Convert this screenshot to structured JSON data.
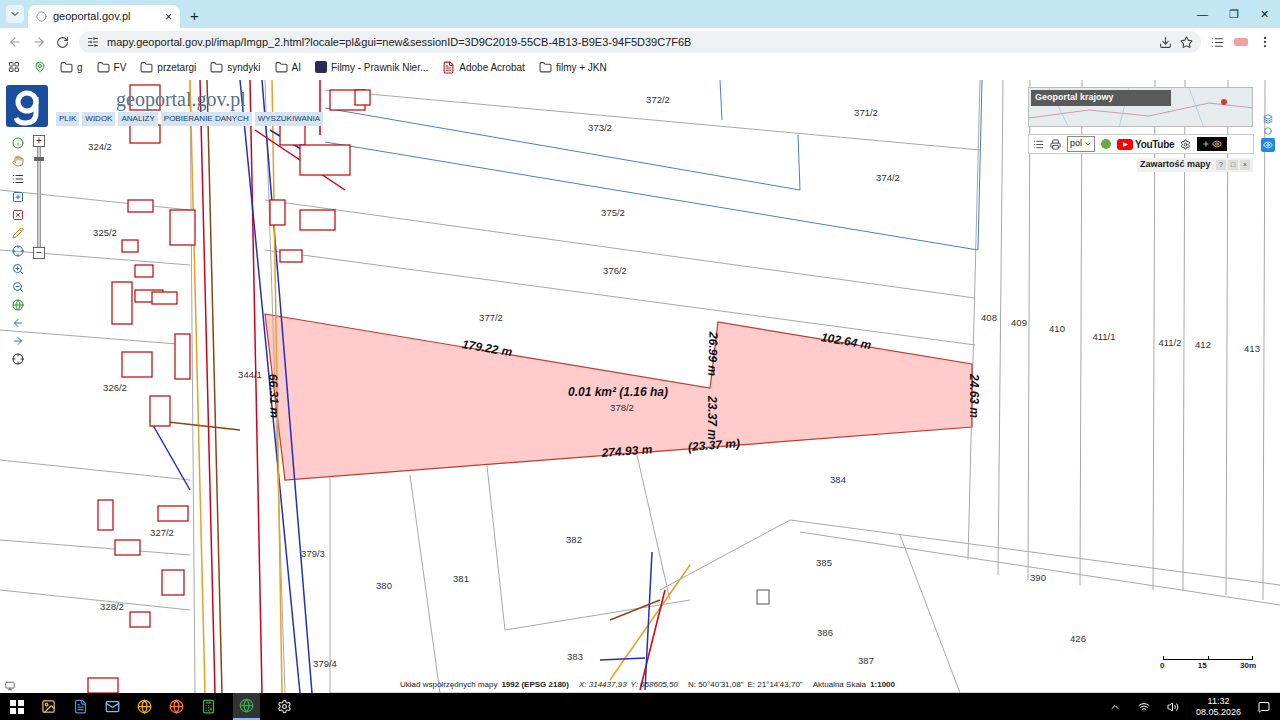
{
  "browser": {
    "tab_title": "geoportal.gov.pl",
    "tab_close": "×",
    "new_tab": "+",
    "window_controls": [
      "—",
      "❐",
      "✕"
    ],
    "url": "mapy.geoportal.gov.pl/imap/Imgp_2.html?locale=pl&gui=new&sessionID=3D9C2019-55CB-4B13-B9E3-94F5D39C7F6B"
  },
  "bookmarks": [
    {
      "label": "g",
      "kind": "folder"
    },
    {
      "label": "FV",
      "kind": "folder"
    },
    {
      "label": "przetargi",
      "kind": "folder"
    },
    {
      "label": "syndyki",
      "kind": "folder"
    },
    {
      "label": "AI",
      "kind": "folder"
    },
    {
      "label": "Filmy - Prawnik Nier...",
      "kind": "page"
    },
    {
      "label": "Adobe Acrobat",
      "kind": "pdf"
    },
    {
      "label": "filmy + JKN",
      "kind": "folder"
    }
  ],
  "app": {
    "logo": "geoportal.gov.pl",
    "menu": [
      "PLIK",
      "WIDOK",
      "ANALIZY",
      "POBIERANIE DANYCH",
      "WYSZUKIWANIA"
    ],
    "zoom_in": "+",
    "zoom_out": "−",
    "overview_title": "Geoportal krajowy",
    "language": "pol",
    "youtube": "YouTube",
    "panel_title": "Zawartość mapy",
    "panel_buttons": [
      "?",
      "□",
      "×"
    ]
  },
  "map": {
    "parcels": [
      {
        "label": "372/2"
      },
      {
        "label": "371/2"
      },
      {
        "label": "373/2"
      },
      {
        "label": "374/2"
      },
      {
        "label": "375/2"
      },
      {
        "label": "376/2"
      },
      {
        "label": "377/2"
      },
      {
        "label": "378/2"
      },
      {
        "label": "324/2"
      },
      {
        "label": "325/2"
      },
      {
        "label": "326/2"
      },
      {
        "label": "344/1"
      },
      {
        "label": "327/2"
      },
      {
        "label": "328/2"
      },
      {
        "label": "379/3"
      },
      {
        "label": "379/4"
      },
      {
        "label": "380"
      },
      {
        "label": "381"
      },
      {
        "label": "382"
      },
      {
        "label": "383"
      },
      {
        "label": "384"
      },
      {
        "label": "385"
      },
      {
        "label": "386"
      },
      {
        "label": "387"
      },
      {
        "label": "390"
      },
      {
        "label": "426"
      },
      {
        "label": "408"
      },
      {
        "label": "409"
      },
      {
        "label": "410"
      },
      {
        "label": "411/1"
      },
      {
        "label": "411/2"
      },
      {
        "label": "412"
      },
      {
        "label": "413"
      }
    ],
    "selection": {
      "area": "0.01 km² (1.16 ha)"
    },
    "measurements": [
      "179.22 m",
      "102.64 m",
      "274.93 m",
      "66.31 m",
      "26.99 m",
      "23.37 m",
      "(23.37 m)",
      "24.63 m"
    ]
  },
  "scale_bar": {
    "ticks": [
      "0",
      "15",
      "30m"
    ]
  },
  "status_bar": {
    "crs_label": "Układ współrzędnych mapy",
    "crs_value": "1992 (EPSG 2180)",
    "x": "X: 314437,93",
    "y": "Y: 658605,50",
    "n": "N: 50°40'31,08\"",
    "e": "E: 21°14'43,70\"",
    "scale_label": "Aktualna Skala",
    "scale_value": "1:1000"
  },
  "taskbar": {
    "time": "11:32",
    "date": "08.05.2026"
  }
}
